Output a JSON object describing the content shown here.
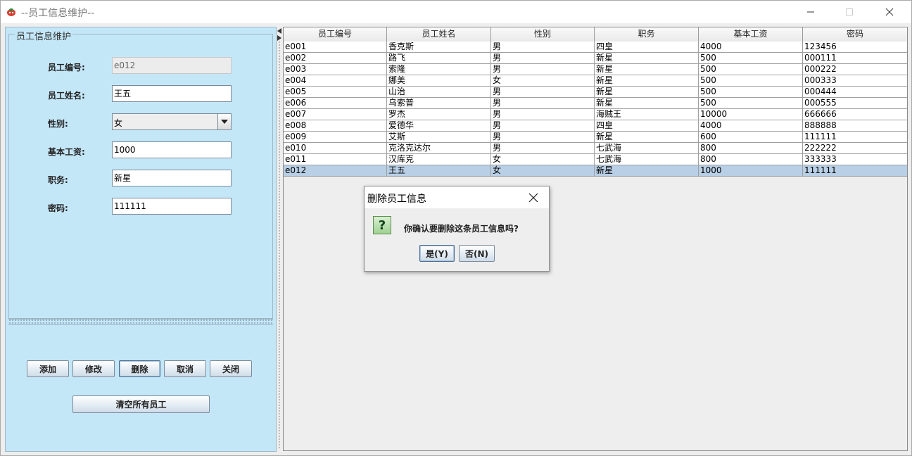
{
  "window": {
    "title": "--员工信息维护--"
  },
  "form": {
    "group_title": "员工信息维护",
    "id_label": "员工编号:",
    "id_value": "e012",
    "name_label": "员工姓名:",
    "name_value": "王五",
    "gender_label": "性别:",
    "gender_value": "女",
    "salary_label": "基本工资:",
    "salary_value": "1000",
    "position_label": "职务:",
    "position_value": "新星",
    "password_label": "密码:",
    "password_value": "111111"
  },
  "buttons": {
    "add": "添加",
    "modify": "修改",
    "delete": "删除",
    "cancel": "取消",
    "close": "关闭",
    "clear_all": "清空所有员工"
  },
  "table": {
    "headers": [
      "员工编号",
      "员工姓名",
      "性别",
      "职务",
      "基本工资",
      "密码"
    ],
    "rows": [
      [
        "e001",
        "香克斯",
        "男",
        "四皇",
        "4000",
        "123456"
      ],
      [
        "e002",
        "路飞",
        "男",
        "新星",
        "500",
        "000111"
      ],
      [
        "e003",
        "索隆",
        "男",
        "新星",
        "500",
        "000222"
      ],
      [
        "e004",
        "娜美",
        "女",
        "新星",
        "500",
        "000333"
      ],
      [
        "e005",
        "山治",
        "男",
        "新星",
        "500",
        "000444"
      ],
      [
        "e006",
        "乌索普",
        "男",
        "新星",
        "500",
        "000555"
      ],
      [
        "e007",
        "罗杰",
        "男",
        "海贼王",
        "10000",
        "666666"
      ],
      [
        "e008",
        "爱德华",
        "男",
        "四皇",
        "4000",
        "888888"
      ],
      [
        "e009",
        "艾斯",
        "男",
        "新星",
        "600",
        "111111"
      ],
      [
        "e010",
        "克洛克达尔",
        "男",
        "七武海",
        "800",
        "222222"
      ],
      [
        "e011",
        "汉库克",
        "女",
        "七武海",
        "800",
        "333333"
      ],
      [
        "e012",
        "王五",
        "女",
        "新星",
        "1000",
        "111111"
      ]
    ],
    "selected_row": 11
  },
  "dialog": {
    "title": "删除员工信息",
    "message": "你确认要删除这条员工信息吗?",
    "yes": "是(Y)",
    "no": "否(N)"
  },
  "colors": {
    "panel_bg": "#c4e7f8",
    "selection": "#b8cfe5",
    "question_icon": "#9fd191"
  }
}
